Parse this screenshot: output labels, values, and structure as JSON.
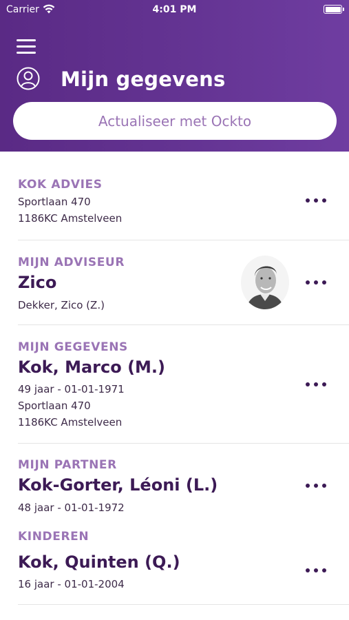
{
  "status_bar": {
    "carrier": "Carrier",
    "time": "4:01 PM"
  },
  "header": {
    "title": "Mijn gegevens",
    "refresh_button": "Actualiseer met Ockto"
  },
  "office": {
    "label": "KOK ADVIES",
    "address": "Sportlaan 470",
    "postcode_city": "1186KC Amstelveen"
  },
  "advisor": {
    "label": "MIJN ADVISEUR",
    "name": "Zico",
    "full_name": "Dekker, Zico (Z.)"
  },
  "personal": {
    "label": "MIJN GEGEVENS",
    "name": "Kok, Marco (M.)",
    "age_birth": "49 jaar - 01-01-1971",
    "address": "Sportlaan 470",
    "postcode_city": "1186KC Amstelveen"
  },
  "partner": {
    "label": "MIJN PARTNER",
    "name": "Kok-Gorter, Léoni (L.)",
    "age_birth": "48 jaar - 01-01-1972"
  },
  "children": {
    "label": "KINDEREN",
    "items": [
      {
        "name": "Kok, Quinten (Q.)",
        "age_birth": "16 jaar - 01-01-2004"
      }
    ]
  },
  "colors": {
    "header_gradient_start": "#5a2a85",
    "header_gradient_end": "#6f3da1",
    "accent_label": "#9a74b5",
    "name_text": "#3c1a55"
  },
  "icons": [
    "wifi-icon",
    "battery-icon",
    "menu-icon",
    "profile-icon",
    "more-icon"
  ]
}
